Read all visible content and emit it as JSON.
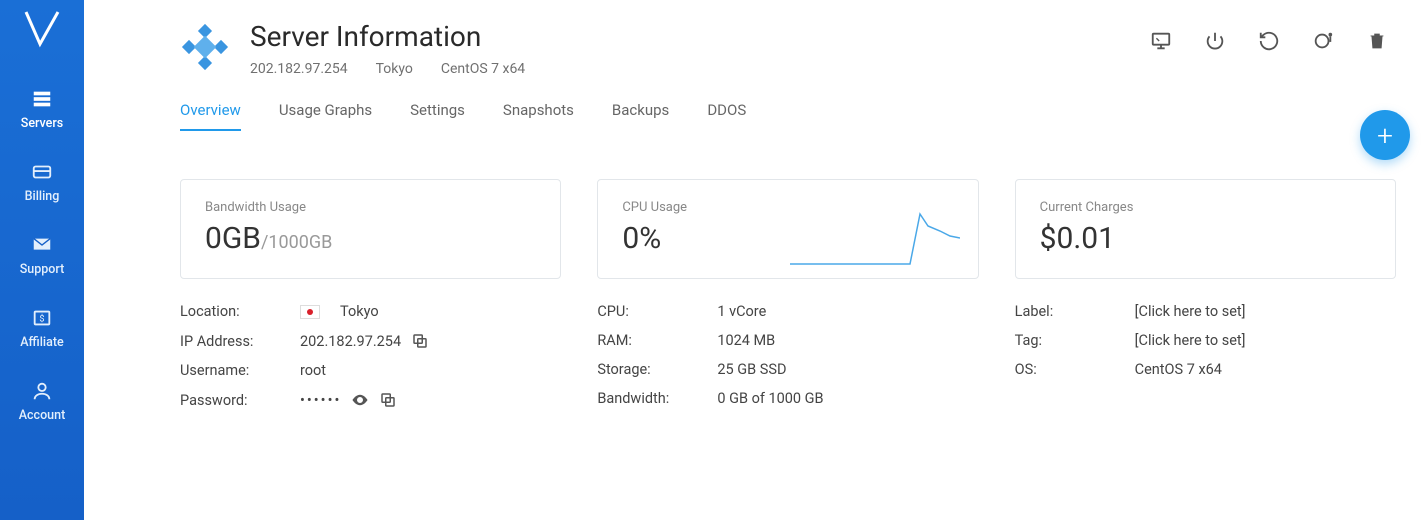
{
  "sidebar": {
    "items": [
      {
        "label": "Servers"
      },
      {
        "label": "Billing"
      },
      {
        "label": "Support"
      },
      {
        "label": "Affiliate"
      },
      {
        "label": "Account"
      }
    ]
  },
  "header": {
    "title": "Server Information",
    "ip": "202.182.97.254",
    "location": "Tokyo",
    "os": "CentOS 7 x64"
  },
  "tabs": [
    {
      "label": "Overview"
    },
    {
      "label": "Usage Graphs"
    },
    {
      "label": "Settings"
    },
    {
      "label": "Snapshots"
    },
    {
      "label": "Backups"
    },
    {
      "label": "DDOS"
    }
  ],
  "cards": {
    "bandwidth": {
      "label": "Bandwidth Usage",
      "value": "0GB",
      "suffix": "/1000GB"
    },
    "cpu": {
      "label": "CPU Usage",
      "value": "0%"
    },
    "charges": {
      "label": "Current Charges",
      "value": "$0.01"
    }
  },
  "details": {
    "col1": {
      "location_key": "Location:",
      "location_val": "Tokyo",
      "ip_key": "IP Address:",
      "ip_val": "202.182.97.254",
      "user_key": "Username:",
      "user_val": "root",
      "pass_key": "Password:",
      "pass_val": "••••••"
    },
    "col2": {
      "cpu_key": "CPU:",
      "cpu_val": "1 vCore",
      "ram_key": "RAM:",
      "ram_val": "1024 MB",
      "storage_key": "Storage:",
      "storage_val": "25 GB SSD",
      "bandwidth_key": "Bandwidth:",
      "bandwidth_val": "0 GB of 1000 GB"
    },
    "col3": {
      "label_key": "Label:",
      "label_val": "[Click here to set]",
      "tag_key": "Tag:",
      "tag_val": "[Click here to set]",
      "os_key": "OS:",
      "os_val": "CentOS 7 x64"
    }
  }
}
